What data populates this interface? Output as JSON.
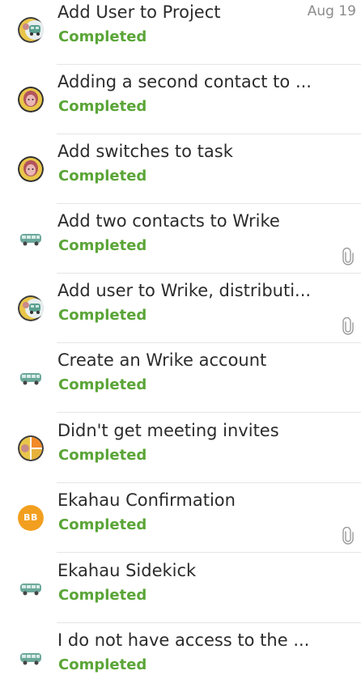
{
  "tasks": [
    {
      "title": "Add User to Project",
      "status": "Completed",
      "date": "Aug 19",
      "avatar_icon": "grouped-avatar-icon",
      "attachment": false
    },
    {
      "title": "Adding a second contact to ...",
      "status": "Completed",
      "avatar_icon": "person-avatar-icon",
      "attachment": false
    },
    {
      "title": "Add switches to task",
      "status": "Completed",
      "avatar_icon": "person-avatar-icon",
      "attachment": false
    },
    {
      "title": "Add two contacts to Wrike",
      "status": "Completed",
      "avatar_icon": "bus-avatar-icon",
      "attachment": true
    },
    {
      "title": "Add user to Wrike, distributi...",
      "status": "Completed",
      "avatar_icon": "grouped-avatar-icon",
      "attachment": true
    },
    {
      "title": "Create an Wrike account",
      "status": "Completed",
      "avatar_icon": "bus-avatar-icon",
      "attachment": false
    },
    {
      "title": "Didn't get meeting invites",
      "status": "Completed",
      "avatar_icon": "multi-avatar-icon",
      "attachment": false
    },
    {
      "title": "Ekahau Confirmation",
      "status": "Completed",
      "avatar_icon": "initials-avatar",
      "avatar_initials": "BB",
      "attachment": true
    },
    {
      "title": "Ekahau Sidekick",
      "status": "Completed",
      "avatar_icon": "bus-avatar-icon",
      "attachment": false
    },
    {
      "title": "I do not have access to the ...",
      "status": "Completed",
      "avatar_icon": "bus-avatar-icon",
      "attachment": false
    }
  ],
  "colors": {
    "status_completed": "#5aa537",
    "initials_bg": "#f29f1f",
    "title_text": "#2b2b2b",
    "date_text": "#8c8c8c"
  }
}
